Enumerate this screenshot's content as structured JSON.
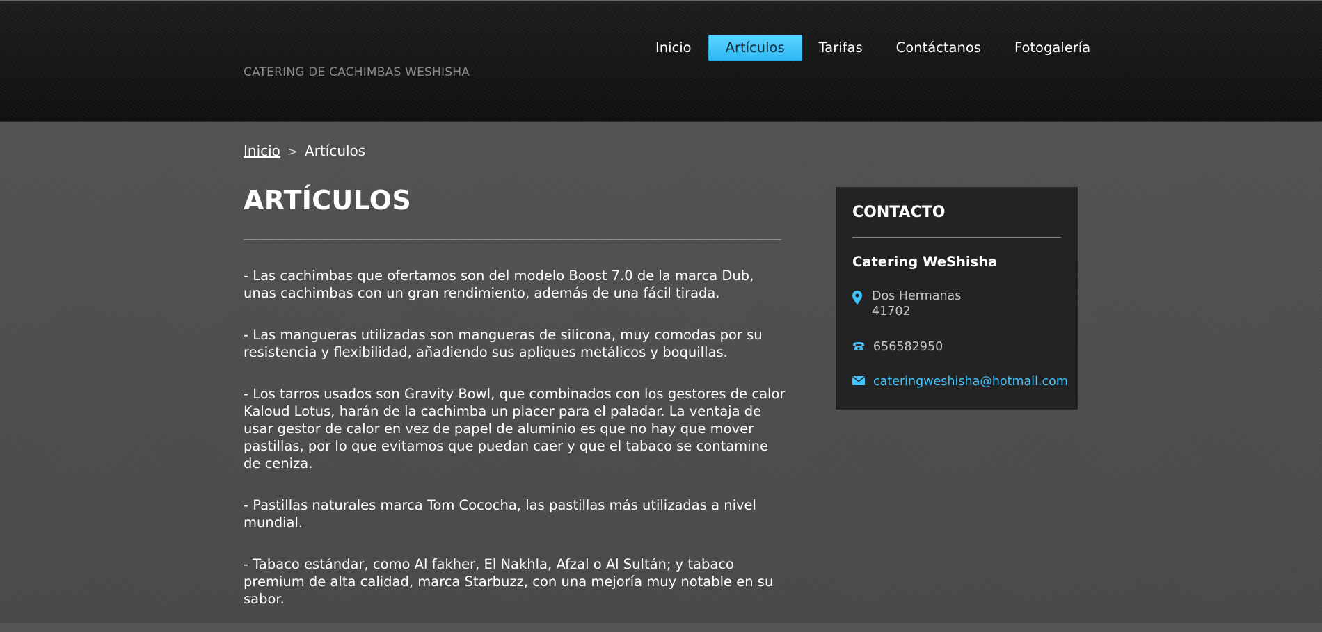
{
  "header": {
    "site_name": "CATERING DE CACHIMBAS WESHISHA",
    "nav": [
      {
        "label": "Inicio",
        "active": false
      },
      {
        "label": "Artículos",
        "active": true
      },
      {
        "label": "Tarifas",
        "active": false
      },
      {
        "label": "Contáctanos",
        "active": false
      },
      {
        "label": "Fotogalería",
        "active": false
      }
    ]
  },
  "breadcrumb": {
    "home": "Inicio",
    "separator": ">",
    "current": "Artículos"
  },
  "main": {
    "title": "ARTÍCULOS",
    "paragraphs": [
      " - Las cachimbas que ofertamos son del modelo Boost 7.0 de la marca Dub, unas cachimbas con un gran rendimiento, además de una fácil tirada.",
      " - Las mangueras utilizadas son mangueras de silicona, muy comodas por su resistencia y flexibilidad, añadiendo sus apliques metálicos y boquillas.",
      " - Los tarros usados son Gravity Bowl, que combinados con los gestores de calor Kaloud Lotus, harán de la cachimba un placer para el paladar. La ventaja de usar gestor de calor en vez de papel de aluminio es que no hay que mover pastillas, por lo que evitamos que puedan caer y que el tabaco se contamine de ceniza.",
      " - Pastillas naturales marca Tom Cococha, las pastillas más utilizadas a nivel mundial.",
      " - Tabaco estándar, como Al fakher, El Nakhla, Afzal o Al Sultán; y tabaco premium de alta calidad, marca Starbuzz, con una mejoría muy notable en su sabor."
    ]
  },
  "contact": {
    "title": "CONTACTO",
    "company": "Catering WeShisha",
    "address_line1": "Dos Hermanas",
    "address_line2": "41702",
    "phone": "656582950",
    "email": "cateringweshisha@hotmail.com",
    "icons": {
      "address": "map-pin-icon",
      "phone": "phone-icon",
      "email": "envelope-icon"
    }
  },
  "colors": {
    "accent": "#3fc4ff",
    "nav_active_bg": "#2ab8f2",
    "header_bg": "#141414",
    "page_bg": "#4d4d4d",
    "sidebar_bg": "#232323"
  }
}
